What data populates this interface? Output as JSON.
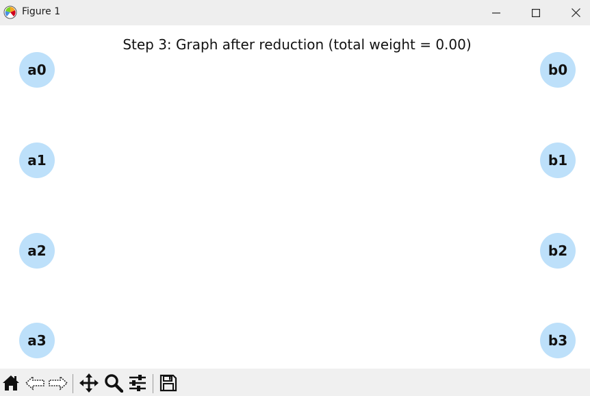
{
  "window": {
    "title": "Figure 1",
    "icon": "matplotlib-icon",
    "controls": [
      "minimize-icon",
      "maximize-icon",
      "close-icon"
    ]
  },
  "figure": {
    "title": "Step 3: Graph after reduction (total weight = 0.00)",
    "node_color": "#bde0fa",
    "left_nodes": [
      "a0",
      "a1",
      "a2",
      "a3"
    ],
    "right_nodes": [
      "b0",
      "b1",
      "b2",
      "b3"
    ],
    "edges": []
  },
  "toolbar": {
    "buttons": [
      "home-icon",
      "back-icon",
      "forward-icon",
      "pan-icon",
      "zoom-icon",
      "configure-subplots-icon",
      "save-icon"
    ]
  }
}
